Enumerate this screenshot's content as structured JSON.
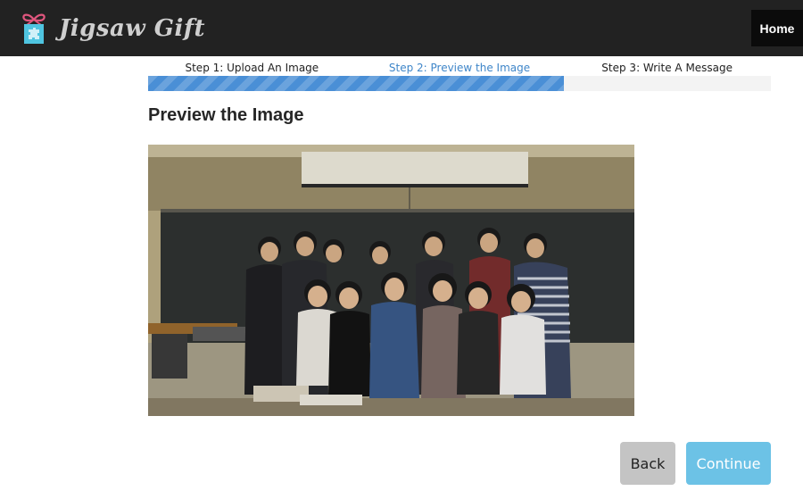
{
  "header": {
    "brand_name": "Jigsaw Gift",
    "brand_icon": "gift-puzzle-icon",
    "nav_home": "Home"
  },
  "steps": [
    {
      "label": "Step 1: Upload An Image",
      "state": "done"
    },
    {
      "label": "Step 2: Preview the Image",
      "state": "active"
    },
    {
      "label": "Step 3: Write A Message",
      "state": "pending"
    }
  ],
  "progress": {
    "fraction": 0.667
  },
  "main": {
    "title": "Preview the Image"
  },
  "buttons": {
    "back": "Back",
    "continue": "Continue"
  },
  "colors": {
    "header_bg": "#222222",
    "progress_fill": "#4a8fd6",
    "active_step": "#3f86c9",
    "continue_bg": "#6cc2e6",
    "back_bg": "#c4c4c4"
  }
}
